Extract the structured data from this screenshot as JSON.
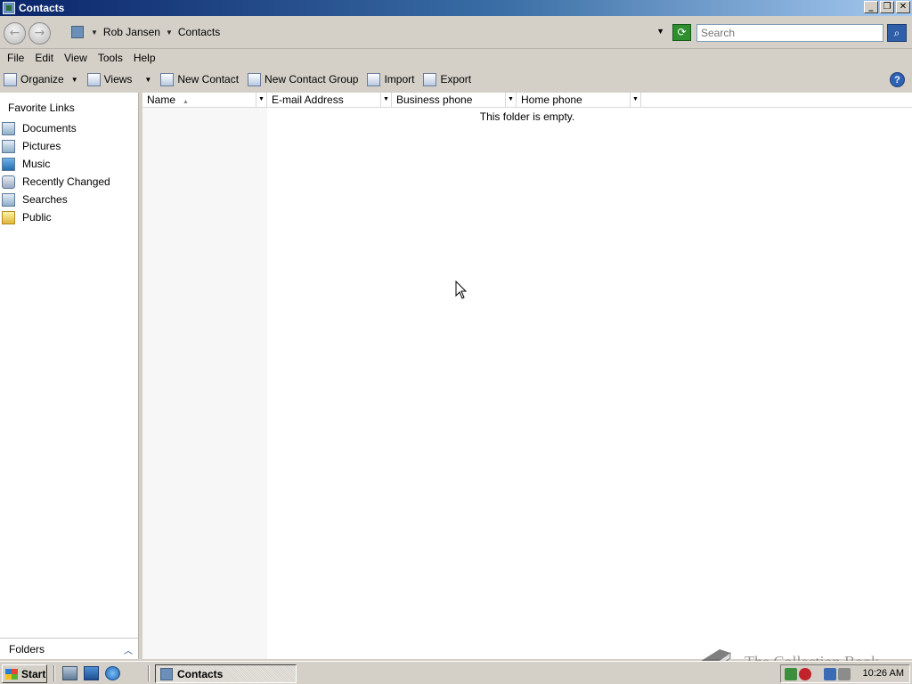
{
  "window": {
    "title": "Contacts",
    "controls": {
      "minimize": "_",
      "maximize": "❐",
      "close": "✕"
    }
  },
  "address_bar": {
    "crumbs": [
      "Rob Jansen",
      "Contacts"
    ],
    "search_placeholder": "Search"
  },
  "menu": [
    "File",
    "Edit",
    "View",
    "Tools",
    "Help"
  ],
  "command_bar": {
    "organize": "Organize",
    "views": "Views",
    "new_contact": "New Contact",
    "new_contact_group": "New Contact Group",
    "import": "Import",
    "export": "Export",
    "help": "?"
  },
  "nav_pane": {
    "header": "Favorite Links",
    "links": [
      "Documents",
      "Pictures",
      "Music",
      "Recently Changed",
      "Searches",
      "Public"
    ],
    "folders_label": "Folders"
  },
  "content": {
    "columns": [
      "Name",
      "E-mail Address",
      "Business phone",
      "Home phone"
    ],
    "empty_message": "This folder is empty."
  },
  "taskbar": {
    "start_label": "Start",
    "task_label": "Contacts",
    "clock": "10:26 AM"
  },
  "watermark": "The Collection Book"
}
